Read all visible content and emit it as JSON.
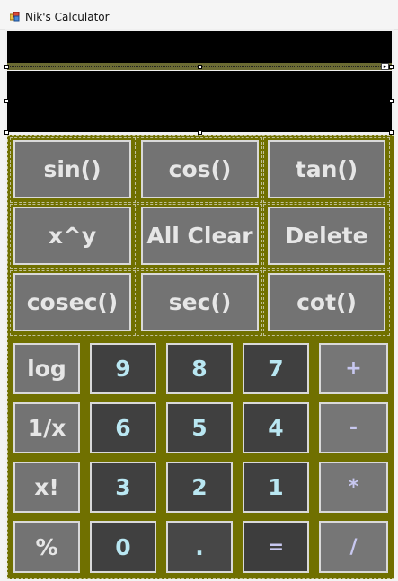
{
  "window": {
    "title": "Nik's Calculator"
  },
  "display": {
    "expression": "",
    "result": ""
  },
  "rows": [
    {
      "buttons": [
        {
          "label": "sin()",
          "name": "sin-button"
        },
        {
          "label": "cos()",
          "name": "cos-button"
        },
        {
          "label": "tan()",
          "name": "tan-button"
        }
      ]
    },
    {
      "buttons": [
        {
          "label": "x^y",
          "name": "power-button"
        },
        {
          "label": "All Clear",
          "name": "all-clear-button"
        },
        {
          "label": "Delete",
          "name": "delete-button"
        }
      ]
    },
    {
      "buttons": [
        {
          "label": "cosec()",
          "name": "cosec-button"
        },
        {
          "label": "sec()",
          "name": "sec-button"
        },
        {
          "label": "cot()",
          "name": "cot-button"
        }
      ]
    },
    {
      "buttons": [
        {
          "label": "log",
          "name": "log-button"
        },
        {
          "label": "9",
          "name": "digit-9-button"
        },
        {
          "label": "8",
          "name": "digit-8-button"
        },
        {
          "label": "7",
          "name": "digit-7-button"
        },
        {
          "label": "+",
          "name": "plus-button"
        }
      ]
    },
    {
      "buttons": [
        {
          "label": "1/x",
          "name": "reciprocal-button"
        },
        {
          "label": "6",
          "name": "digit-6-button"
        },
        {
          "label": "5",
          "name": "digit-5-button"
        },
        {
          "label": "4",
          "name": "digit-4-button"
        },
        {
          "label": "-",
          "name": "minus-button"
        }
      ]
    },
    {
      "buttons": [
        {
          "label": "x!",
          "name": "factorial-button"
        },
        {
          "label": "3",
          "name": "digit-3-button"
        },
        {
          "label": "2",
          "name": "digit-2-button"
        },
        {
          "label": "1",
          "name": "digit-1-button"
        },
        {
          "label": "*",
          "name": "multiply-button"
        }
      ]
    },
    {
      "buttons": [
        {
          "label": "%",
          "name": "percent-button"
        },
        {
          "label": "0",
          "name": "digit-0-button"
        },
        {
          "label": ".",
          "name": "decimal-button"
        },
        {
          "label": "=",
          "name": "equals-button"
        },
        {
          "label": "/",
          "name": "divide-button"
        }
      ]
    }
  ]
}
